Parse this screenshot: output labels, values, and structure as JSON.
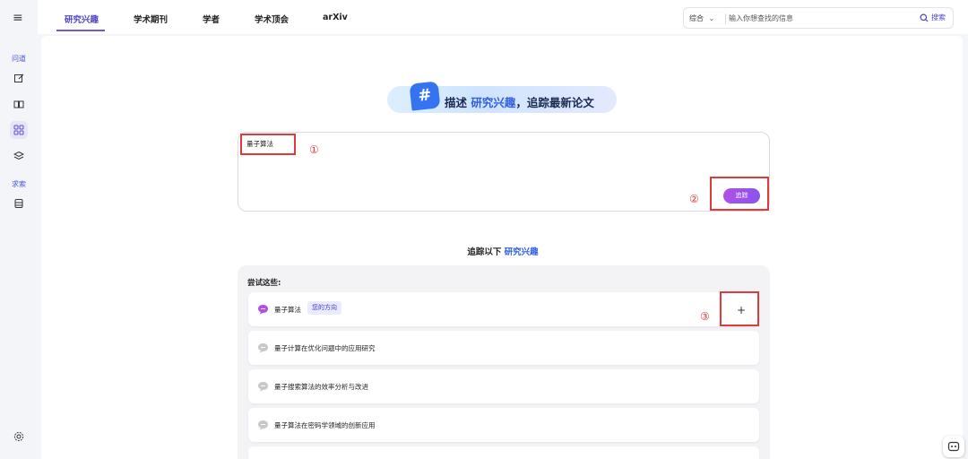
{
  "nav": {
    "tabs": [
      {
        "label": "研究兴趣",
        "active": true
      },
      {
        "label": "学术期刊"
      },
      {
        "label": "学者"
      },
      {
        "label": "学术顶会"
      },
      {
        "label": "arXiv"
      }
    ]
  },
  "search": {
    "scope": "综合",
    "placeholder": "输入你想查找的信息",
    "button_label": "搜索"
  },
  "sidebar": {
    "section_1": "问道",
    "section_2": "求索",
    "icons": [
      "edit-icon",
      "book-icon",
      "grid-icon",
      "layers-icon",
      "database-icon",
      "settings-icon"
    ]
  },
  "hero": {
    "badge": "#",
    "text_prefix": "描述",
    "text_highlight": "研究兴趣",
    "text_suffix": "，追踪最新论文"
  },
  "input": {
    "value": "量子算法",
    "submit_label": "追踪"
  },
  "annotations": {
    "n1": "①",
    "n2": "②",
    "n3": "③"
  },
  "section": {
    "prefix": "追踪以下",
    "highlight": "研究兴趣"
  },
  "suggestions": {
    "label": "尝试这些:",
    "items": [
      {
        "text": "量子算法",
        "tag": "您的方向"
      },
      {
        "text": "量子计算在优化问题中的应用研究"
      },
      {
        "text": "量子搜索算法的效率分析与改进"
      },
      {
        "text": "量子算法在密码学领域的创新应用"
      }
    ],
    "add_label": "+"
  },
  "colors": {
    "accent": "#4f46c8",
    "annotation": "#e03a3a",
    "button_gradient_start": "#b14fe6",
    "button_gradient_end": "#8a54ec"
  }
}
